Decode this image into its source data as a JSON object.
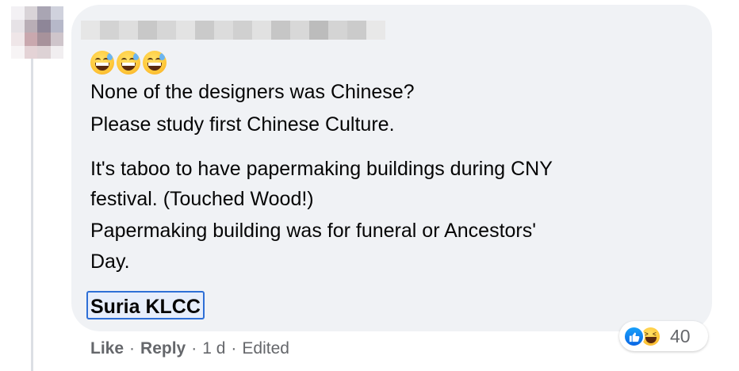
{
  "comment": {
    "emoji_names": [
      "grinning-sweat-icon",
      "grinning-sweat-icon",
      "grinning-sweat-icon"
    ],
    "lines": [
      "None of the designers was Chinese?",
      "Please study first Chinese Culture.",
      "It's taboo to have papermaking buildings during CNY",
      "festival. (Touched Wood!)",
      "Papermaking building was for funeral or Ancestors'",
      "Day."
    ],
    "tag": "Suria KLCC"
  },
  "reactions": {
    "types": [
      "like-icon",
      "haha-icon"
    ],
    "count": "40"
  },
  "actions": {
    "like": "Like",
    "reply": "Reply",
    "time": "1 d",
    "edited": "Edited",
    "separator": "·"
  },
  "colors": {
    "bubble": "#f0f2f5",
    "meta_text": "#65676b",
    "tag_border": "#2e6fd6",
    "like_blue": "#0a66e4"
  }
}
